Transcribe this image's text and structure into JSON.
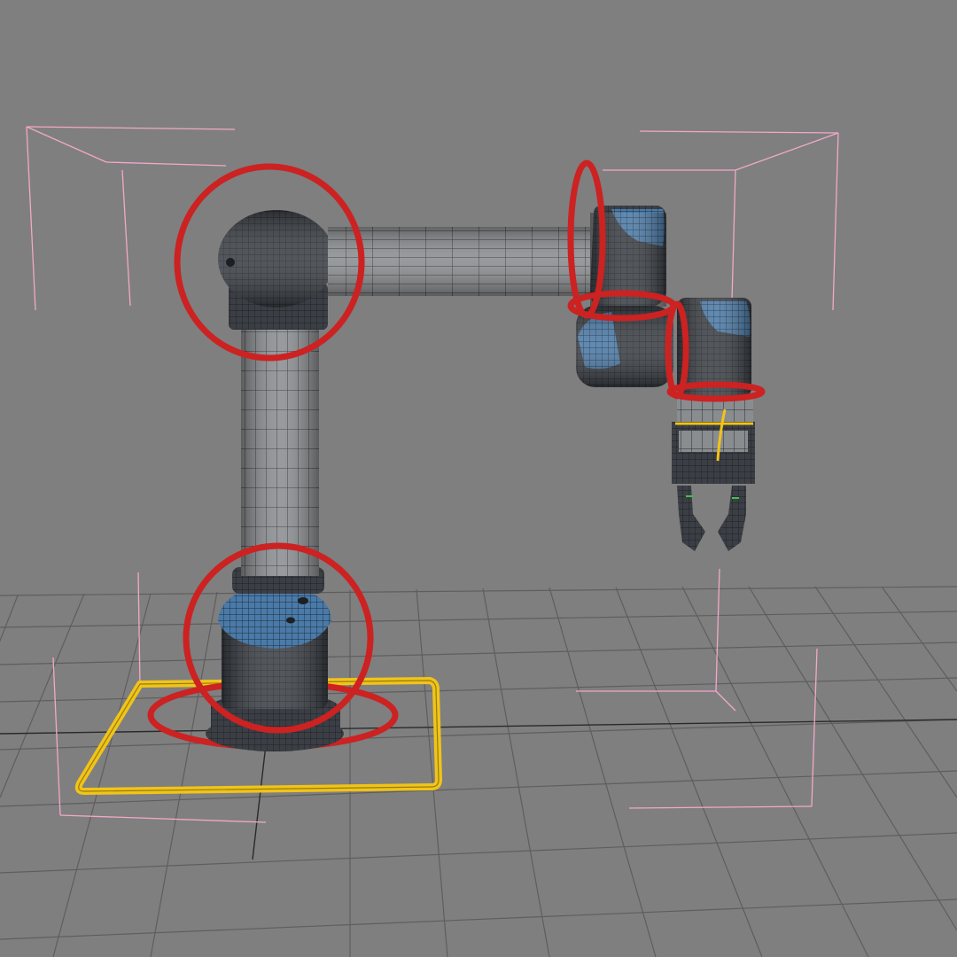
{
  "viewport": {
    "label": "",
    "background": "#7f7f7f"
  },
  "colors": {
    "grid": "#5e5e5e",
    "grid_axis": "#2a2a2a",
    "bounding_box": "#f2a8c8",
    "rotation_gizmo": "#cc2222",
    "base_control": "#f0c419",
    "mesh_dark": "#3b3f45",
    "mesh_light": "#8a8d90",
    "accent_blue": "#4a7aa8",
    "wire": "#1d1f22"
  },
  "scene": {
    "object": "robot-arm-with-gripper",
    "controls": [
      "base-control-square",
      "base-rotation-ring",
      "shoulder-rotation-ring",
      "elbow-rotation-ring",
      "wrist-rotation-ring-1",
      "wrist-rotation-ring-2",
      "wrist-rotation-ring-3"
    ]
  }
}
